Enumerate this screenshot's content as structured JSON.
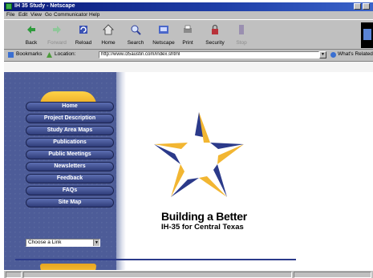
{
  "window": {
    "title": "IH 35 Study - Netscape"
  },
  "menu": [
    "File",
    "Edit",
    "View",
    "Go",
    "Communicator",
    "Help"
  ],
  "toolbar": {
    "buttons": [
      {
        "label": "Back",
        "icon": "back-arrow-icon"
      },
      {
        "label": "Forward",
        "icon": "forward-arrow-icon"
      },
      {
        "label": "Reload",
        "icon": "reload-icon"
      },
      {
        "label": "Home",
        "icon": "home-icon"
      },
      {
        "label": "Search",
        "icon": "search-icon"
      },
      {
        "label": "Netscape",
        "icon": "netscape-icon"
      },
      {
        "label": "Print",
        "icon": "print-icon"
      },
      {
        "label": "Security",
        "icon": "security-lock-icon"
      },
      {
        "label": "Stop",
        "icon": "stop-icon"
      }
    ]
  },
  "location": {
    "bookmarks_label": "Bookmarks",
    "location_label": "Location:",
    "url": "http://www.i35austin.com/index.shtml",
    "whats_related": "What's Related"
  },
  "nav": {
    "items": [
      "Home",
      "Project Description",
      "Study Area Maps",
      "Publications",
      "Public Meetings",
      "Newsletters",
      "Feedback",
      "FAQs",
      "Site Map"
    ],
    "choose_link": "Choose a Link"
  },
  "main": {
    "tagline_line1": "Building a Better",
    "tagline_line2": "IH-35 for Central Texas"
  },
  "colors": {
    "panel": "#4d5c98",
    "gold": "#f2b632",
    "navy": "#2b3a8a"
  }
}
